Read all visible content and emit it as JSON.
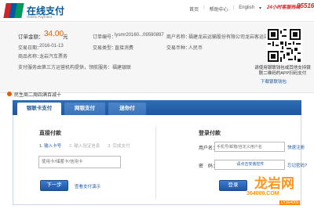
{
  "header": {
    "brand_cn": "在线支付",
    "brand_en": "Online Payment",
    "logo_text": "银联\nUnionPay",
    "nav": [
      "首页",
      "帮助中心",
      "English"
    ],
    "service_label": "24小时客服热线",
    "hotline": "95516"
  },
  "order": {
    "amount_label": "订单金额：",
    "amount_value": "34.00",
    "amount_unit": "元",
    "order_no_label": "订单编号：",
    "order_no_value": "lysmr20160...09590897",
    "merchant_label": "商户名称：",
    "merchant_value": "福建龙岩运输股份有限公司龙岩客运站",
    "date_label": "交易日期：",
    "date_value": "2016-01-13",
    "type_label": "交易类型：",
    "type_value": "直接消费",
    "currency_label": "交易币种：",
    "currency_value": "人民币",
    "product_label": "商品名称：",
    "product_value": "龙岩汽车票务",
    "provider_text": "支付服务由第三方运营机构提供，领航服务：福建银联",
    "qr_tip": "请使用银联钱包或其他支持银联二维码的APP扫码支付",
    "qr_download": "下载银联钱包"
  },
  "notice": "民生周二周四满百减十",
  "tabs": [
    {
      "label": "银联卡支付",
      "active": true
    },
    {
      "label": "网银支付",
      "active": false
    },
    {
      "label": "迷你付",
      "active": false
    }
  ],
  "direct_pay": {
    "title": "直接付款",
    "steps": [
      "1. 输入卡号",
      "2. 输入验证信息",
      "3. 完成支付"
    ],
    "card_placeholder": "使用卡/储蓄卡/信用卡",
    "next_label": "下一步",
    "demo_link": "查看支付演示"
  },
  "login_pay": {
    "title": "登录付款",
    "user_label": "用户名：",
    "user_placeholder": "手机号/邮箱/自定义用户名",
    "forgot_user": "快速注册",
    "pwd_label": "密　码：",
    "pwd_placeholder": "请点击安装控件",
    "forgot_pwd": "忘记密码?",
    "login_label": "登录"
  },
  "watermark": {
    "cn": "龙岩网",
    "url": "364000.COM",
    "tag": "LY364000"
  },
  "colors": {
    "brand_blue": "#005aa0",
    "brand_red": "#d2232a",
    "amount_orange": "#e25b00",
    "tab_bar": "#1f56a0",
    "link": "#1e5aa8"
  }
}
